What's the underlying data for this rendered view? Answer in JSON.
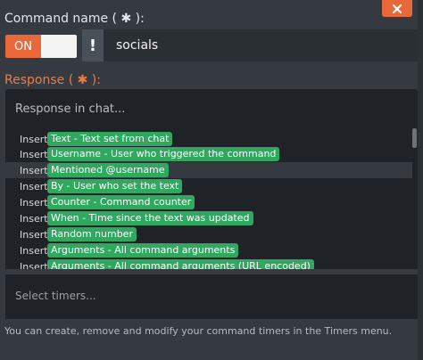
{
  "labels": {
    "command_name": "Command name",
    "response": "Response",
    "required_mark": "✱"
  },
  "toggle": {
    "state_label": "ON",
    "on": true
  },
  "warning_button": {
    "glyph": "!"
  },
  "command": {
    "name": "socials"
  },
  "response": {
    "placeholder": "Response in chat..."
  },
  "dropdown": {
    "insert_word": "Insert",
    "selected_index": 2,
    "items": [
      "Text - Text set from chat",
      "Username - User who triggered the command",
      "Mentioned @username",
      "By - User who set the text",
      "Counter - Command counter",
      "When - Time since the text was updated",
      "Random number",
      "Arguments - All command arguments",
      "Arguments - All command arguments (URL encoded)"
    ]
  },
  "timers": {
    "placeholder": "Select timers..."
  },
  "info": {
    "text": "You can create, remove and modify your command timers in the Timers menu."
  },
  "icons": {
    "close": "close-icon",
    "warning": "exclamation-icon"
  },
  "colors": {
    "accent": "#e8683a",
    "badge": "#31a860",
    "background": "#343a40",
    "input": "#1f2327"
  }
}
